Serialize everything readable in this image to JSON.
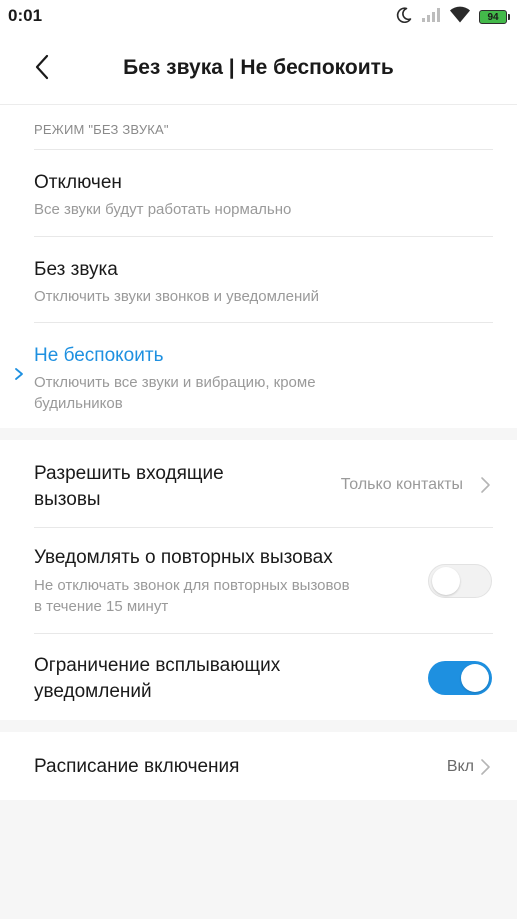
{
  "status_bar": {
    "time": "0:01",
    "battery_level": "94",
    "icons": [
      "moon-icon",
      "signal-icon",
      "wifi-icon",
      "battery-icon"
    ]
  },
  "header": {
    "title": "Без звука | Не беспокоить",
    "back_icon": "chevron-left-icon"
  },
  "silent_mode": {
    "section_title": "РЕЖИМ \"БЕЗ ЗВУКА\"",
    "options": [
      {
        "title": "Отключен",
        "subtitle": "Все звуки будут работать нормально",
        "selected": false
      },
      {
        "title": "Без звука",
        "subtitle": "Отключить звуки звонков и уведомлений",
        "selected": false
      },
      {
        "title": "Не беспокоить",
        "subtitle": "Отключить все звуки и вибрацию, кроме будильников",
        "selected": true
      }
    ]
  },
  "settings": {
    "allow_calls": {
      "title": "Разрешить входящие вызовы",
      "value": "Только контакты"
    },
    "repeat_calls": {
      "title": "Уведомлять о повторных вызовах",
      "subtitle": "Не отключать звонок для повторных вызовов в течение 15 минут",
      "enabled": false
    },
    "popup_limit": {
      "title": "Ограничение всплывающих уведомлений",
      "enabled": true
    }
  },
  "schedule": {
    "title": "Расписание включения",
    "value": "Вкл"
  },
  "colors": {
    "accent": "#1e90e0",
    "background": "#f6f6f6",
    "card": "#ffffff",
    "secondary_text": "#9a9a9a",
    "battery": "#43b94a"
  }
}
